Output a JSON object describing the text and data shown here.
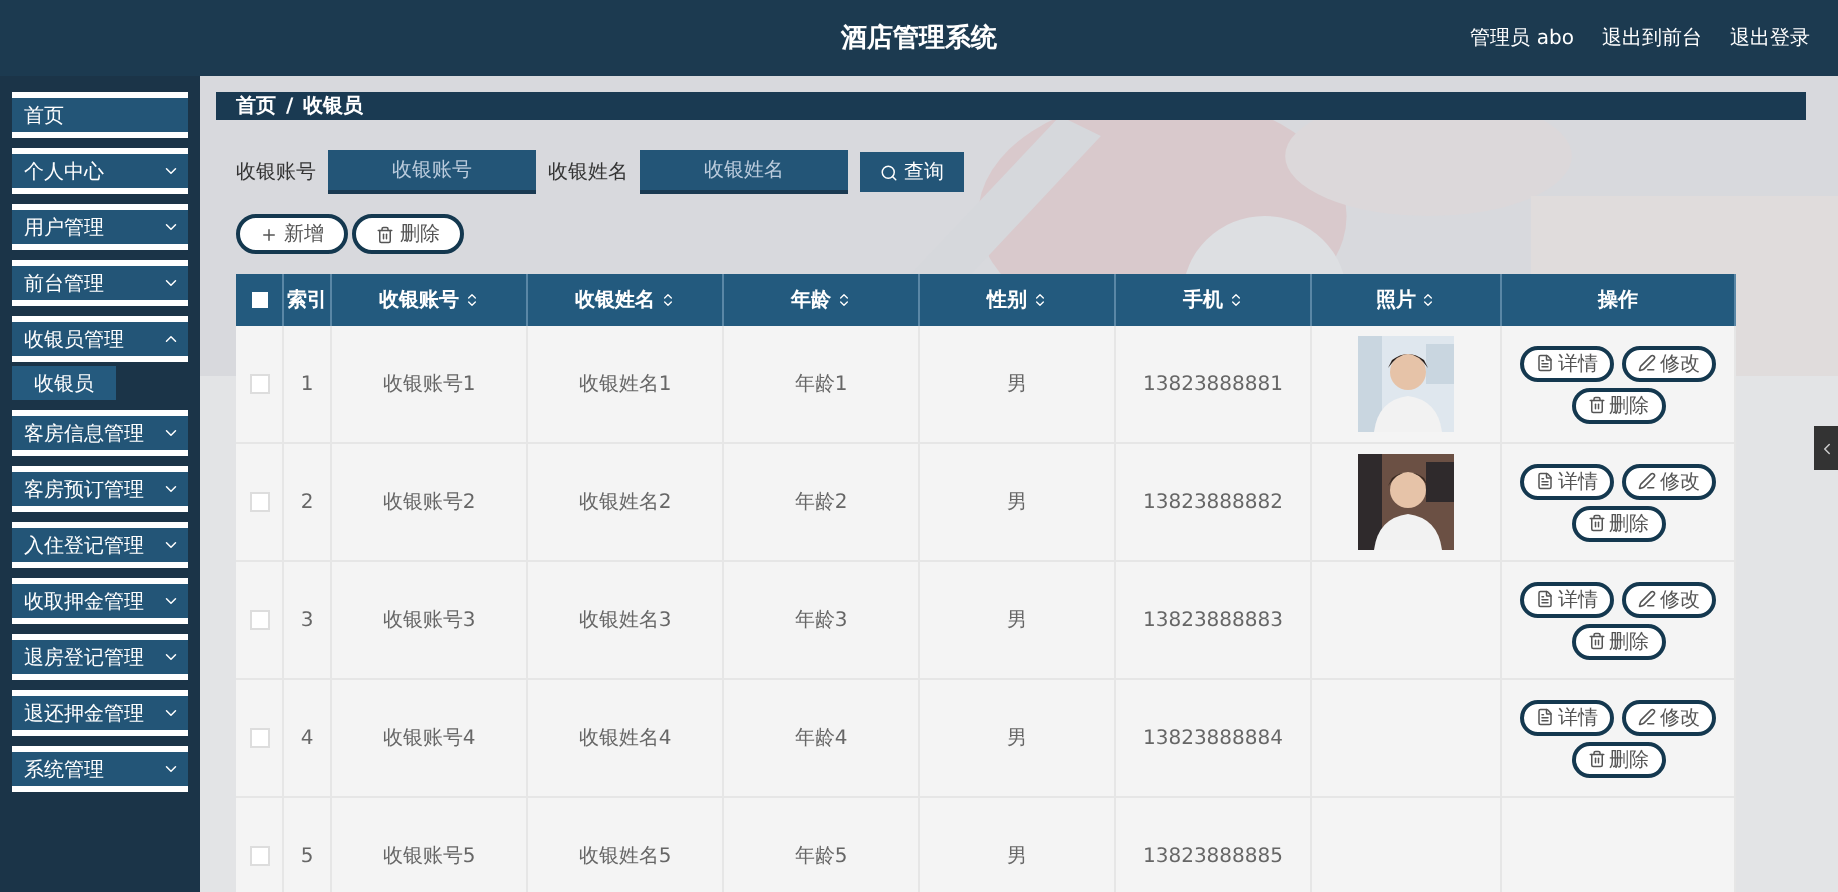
{
  "header": {
    "title": "酒店管理系统",
    "user": "管理员 abo",
    "links": [
      "退出到前台",
      "退出登录"
    ]
  },
  "sidebar": {
    "items": [
      {
        "label": "首页",
        "expandable": false
      },
      {
        "label": "个人中心",
        "expandable": true,
        "expanded": false
      },
      {
        "label": "用户管理",
        "expandable": true,
        "expanded": false
      },
      {
        "label": "前台管理",
        "expandable": true,
        "expanded": false
      },
      {
        "label": "收银员管理",
        "expandable": true,
        "expanded": true,
        "children": [
          {
            "label": "收银员",
            "selected": true
          }
        ]
      },
      {
        "label": "客房信息管理",
        "expandable": true,
        "expanded": false
      },
      {
        "label": "客房预订管理",
        "expandable": true,
        "expanded": false
      },
      {
        "label": "入住登记管理",
        "expandable": true,
        "expanded": false
      },
      {
        "label": "收取押金管理",
        "expandable": true,
        "expanded": false
      },
      {
        "label": "退房登记管理",
        "expandable": true,
        "expanded": false
      },
      {
        "label": "退还押金管理",
        "expandable": true,
        "expanded": false
      },
      {
        "label": "系统管理",
        "expandable": true,
        "expanded": false
      }
    ]
  },
  "breadcrumb": {
    "items": [
      "首页",
      "收银员"
    ],
    "separator": "/"
  },
  "search": {
    "fields": [
      {
        "label": "收银账号",
        "placeholder": "收银账号"
      },
      {
        "label": "收银姓名",
        "placeholder": "收银姓名"
      }
    ],
    "button": "查询"
  },
  "actions": [
    {
      "kind": "add",
      "label": "新增"
    },
    {
      "kind": "delete",
      "label": "删除"
    }
  ],
  "table": {
    "select_all": {
      "checked": false
    },
    "columns": [
      {
        "label": "索引",
        "sortable": false
      },
      {
        "label": "收银账号",
        "sortable": true
      },
      {
        "label": "收银姓名",
        "sortable": true
      },
      {
        "label": "年龄",
        "sortable": true
      },
      {
        "label": "性别",
        "sortable": true
      },
      {
        "label": "手机",
        "sortable": true
      },
      {
        "label": "照片",
        "sortable": true
      },
      {
        "label": "操作",
        "sortable": false
      }
    ],
    "rows": [
      {
        "checked": false,
        "cells": [
          "1",
          "收银账号1",
          "收银姓名1",
          "年龄1",
          "男",
          "13823888881"
        ],
        "actions": [
          "详情",
          "修改",
          "删除"
        ]
      },
      {
        "checked": false,
        "cells": [
          "2",
          "收银账号2",
          "收银姓名2",
          "年龄2",
          "男",
          "13823888882"
        ],
        "actions": [
          "详情",
          "修改",
          "删除"
        ]
      },
      {
        "checked": false,
        "cells": [
          "3",
          "收银账号3",
          "收银姓名3",
          "年龄3",
          "男",
          "13823888883"
        ],
        "actions": [
          "详情",
          "修改",
          "删除"
        ]
      },
      {
        "checked": false,
        "cells": [
          "4",
          "收银账号4",
          "收银姓名4",
          "年龄4",
          "男",
          "13823888884"
        ],
        "actions": [
          "详情",
          "修改",
          "删除"
        ]
      },
      {
        "checked": false,
        "cells": [
          "5",
          "收银账号5",
          "收银姓名5",
          "年龄5",
          "男",
          "13823888885"
        ]
      }
    ]
  }
}
